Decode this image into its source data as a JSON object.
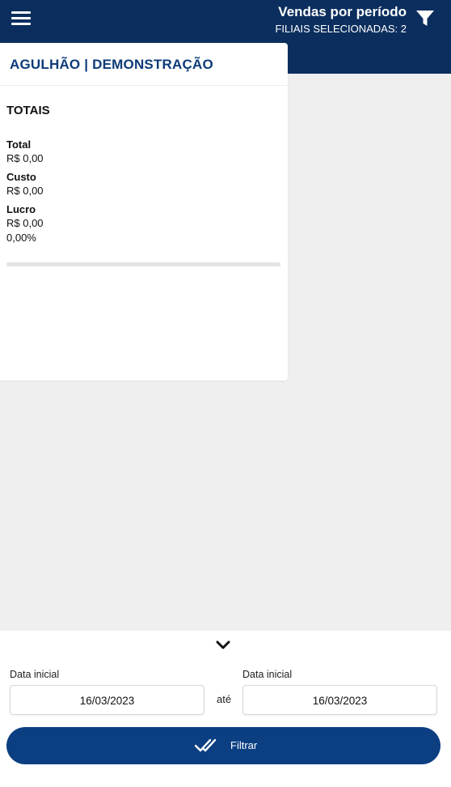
{
  "header": {
    "title": "Vendas por período",
    "subtitle": "FILIAIS SELECIONADAS: 2"
  },
  "card": {
    "title": "AGULHÃO | DEMONSTRAÇÃO",
    "section_title": "TOTAIS",
    "metrics": [
      {
        "label": "Total",
        "value": "R$ 0,00"
      },
      {
        "label": "Custo",
        "value": "R$ 0,00"
      },
      {
        "label": "Lucro",
        "value": "R$ 0,00",
        "extra": "0,00%"
      }
    ]
  },
  "filters": {
    "start_label": "Data inicial",
    "start_value": "16/03/2023",
    "separator": "até",
    "end_label": "Data inicial",
    "end_value": "16/03/2023",
    "submit_label": "Filtrar"
  },
  "colors": {
    "header_bg": "#0b2e5e",
    "accent": "#0d3b78",
    "button_bg": "#0b3f82"
  }
}
